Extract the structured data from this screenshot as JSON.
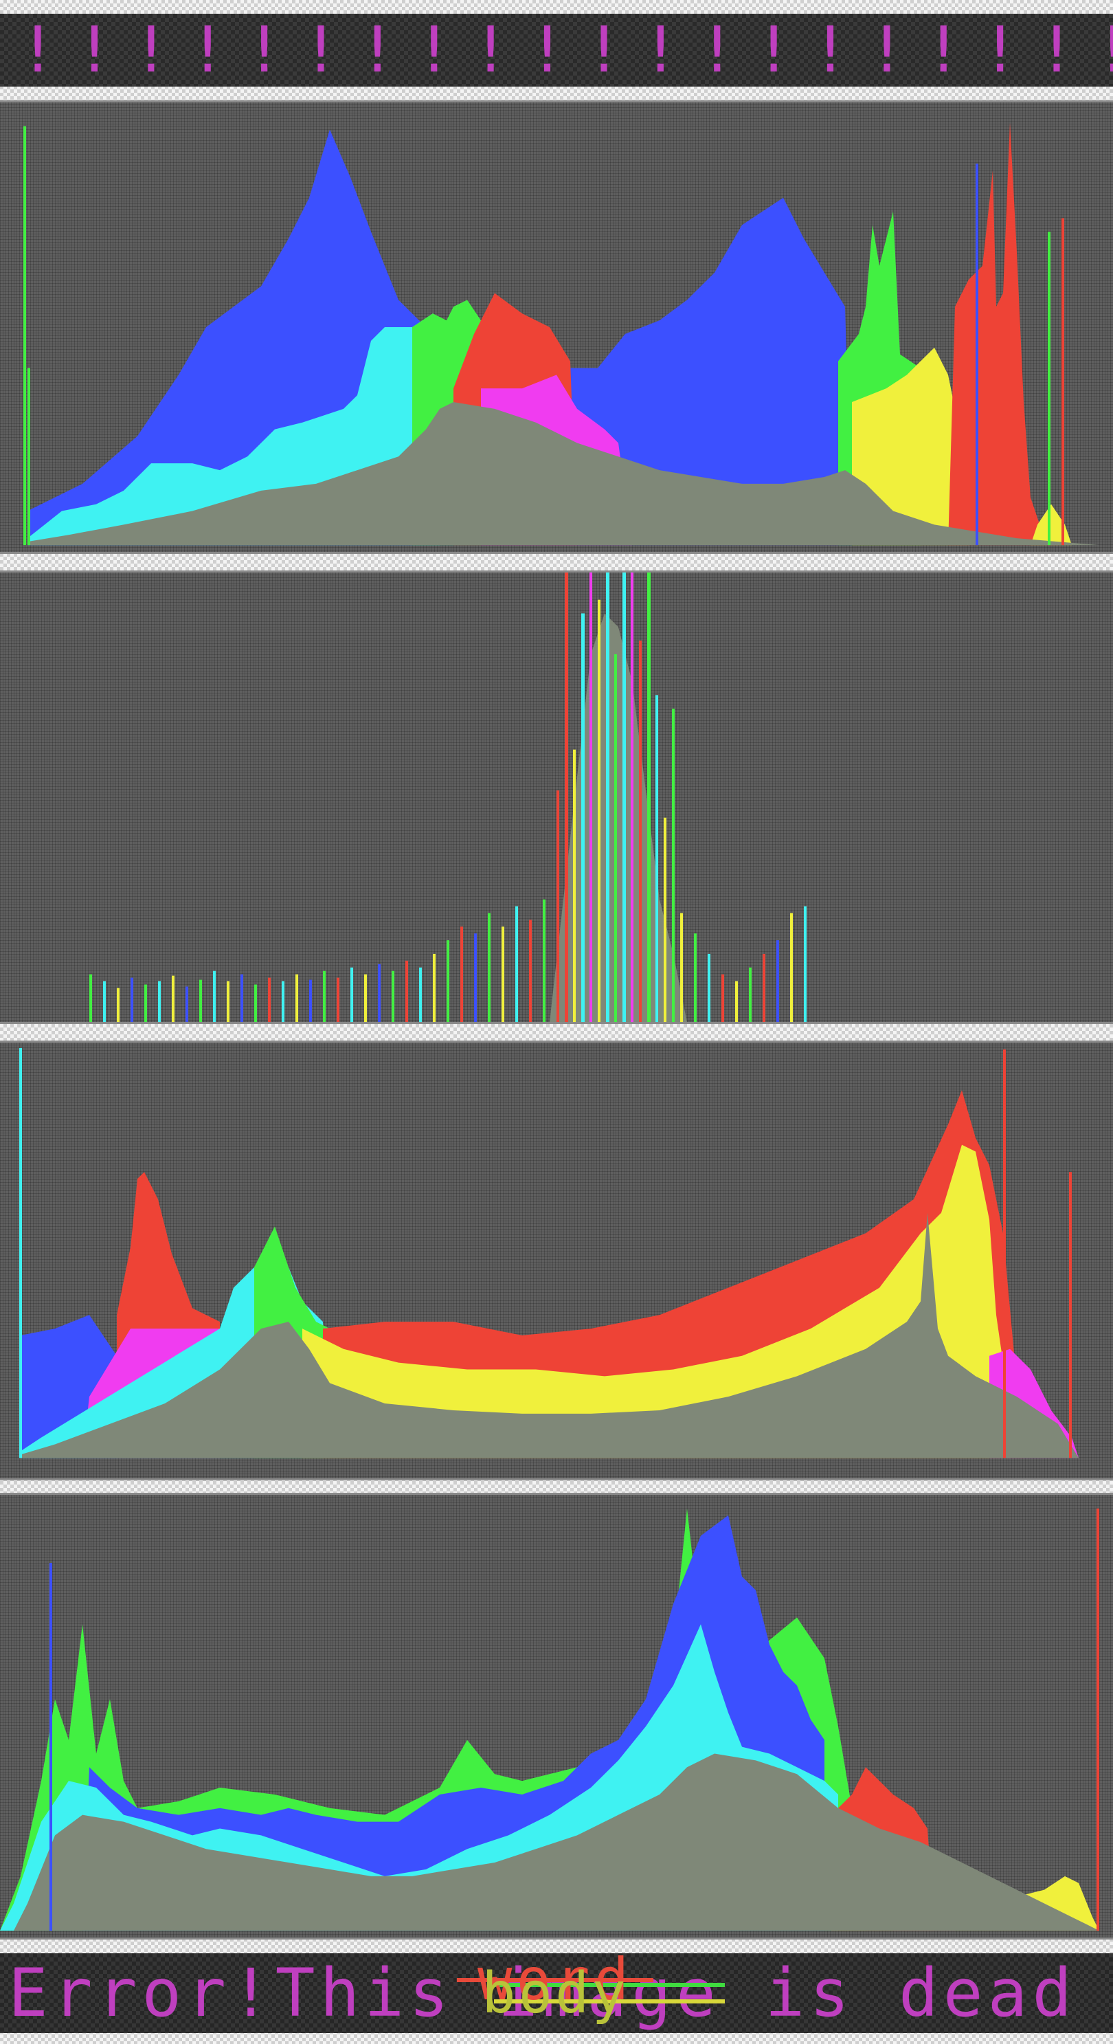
{
  "banner": {
    "text": "!!!!!!!!!!!!!!!!!!!!!!!!!"
  },
  "colors": {
    "panel_background": "#5f5f5f",
    "gray_fill": "#7f8878",
    "cyan": "#3ff2f2",
    "blue": "#3c50ff",
    "green": "#42f042",
    "red": "#ee4336",
    "magenta": "#f03cf0",
    "yellow": "#f0f03c",
    "text_magenta": "#bf3fbf"
  },
  "footer": {
    "prefix": "Error!This ",
    "struck_word": "image",
    "suffix": " is dead",
    "overlay_top": "word",
    "overlay_bottom": "body"
  }
}
